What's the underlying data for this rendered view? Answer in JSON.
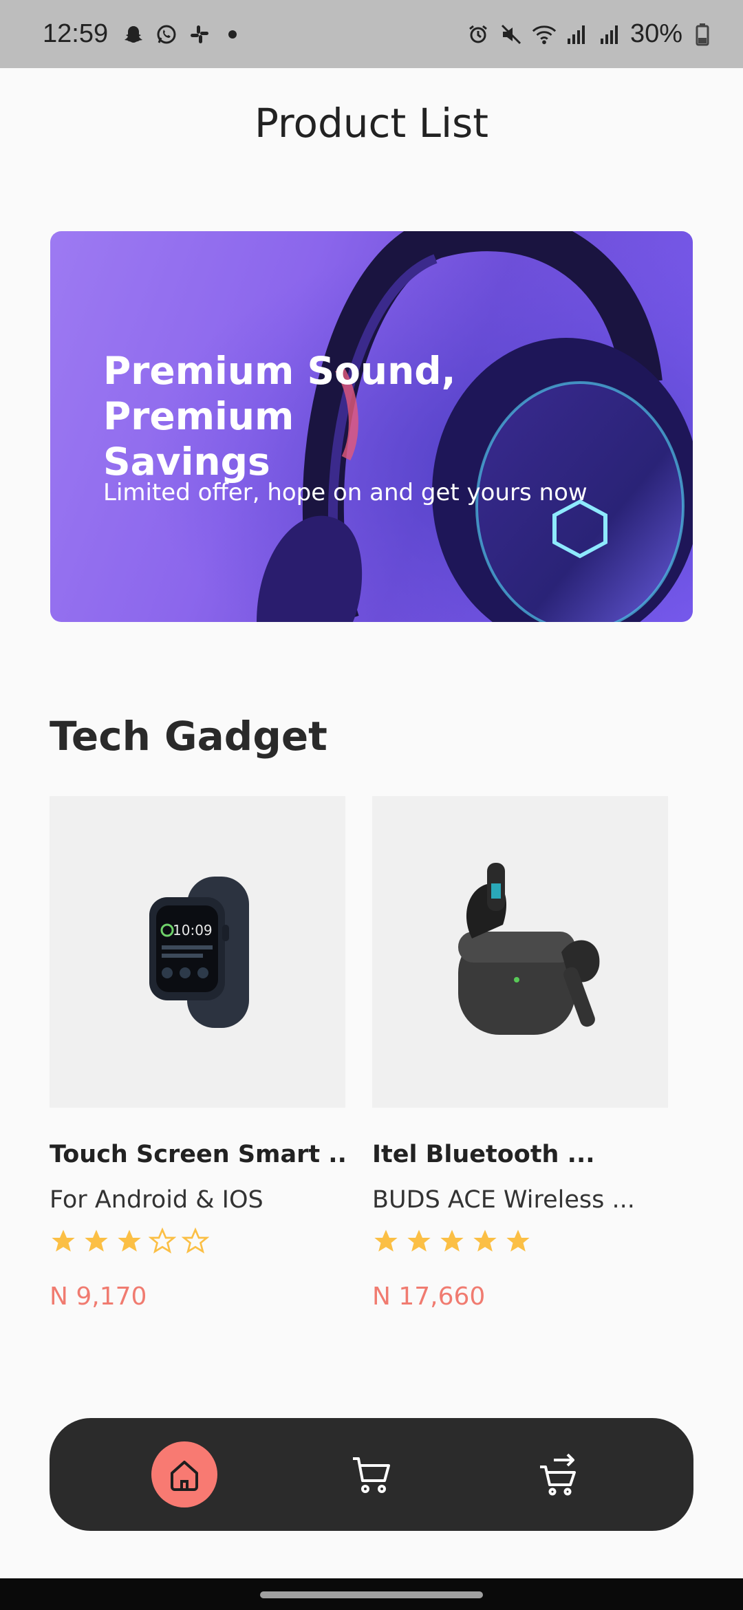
{
  "status_bar": {
    "time": "12:59",
    "battery": "30%",
    "left_icons": [
      "snapchat-icon",
      "whatsapp-icon",
      "slack-icon",
      "dot-icon"
    ],
    "right_icons": [
      "alarm-icon",
      "mute-icon",
      "wifi-icon",
      "signal-icon",
      "signal-icon",
      "battery-icon"
    ]
  },
  "header": {
    "title": "Product List"
  },
  "banner": {
    "heading_line1": "Premium Sound,",
    "heading_line2": "Premium Savings",
    "subtitle": "Limited offer, hope on and get yours now"
  },
  "section": {
    "title": "Tech Gadget"
  },
  "products": [
    {
      "title": "Touch Screen Smart ...",
      "subtitle": "For Android & IOS",
      "rating": 3,
      "max_rating": 5,
      "price": "N 9,170",
      "image_icon": "smartwatch-icon"
    },
    {
      "title": "Itel Bluetooth ...",
      "subtitle": "BUDS ACE Wireless ...",
      "rating": 5,
      "max_rating": 5,
      "price": "N 17,660",
      "image_icon": "earbuds-icon"
    }
  ],
  "nav": {
    "items": [
      {
        "icon": "home-icon",
        "active": true
      },
      {
        "icon": "cart-icon",
        "active": false
      },
      {
        "icon": "checkout-cart-icon",
        "active": false
      }
    ]
  },
  "colors": {
    "accent": "#f87a72",
    "price": "#f07b70",
    "star": "#fbbf45",
    "nav_bg": "#2b2b2b",
    "banner": "#8b66ec"
  }
}
